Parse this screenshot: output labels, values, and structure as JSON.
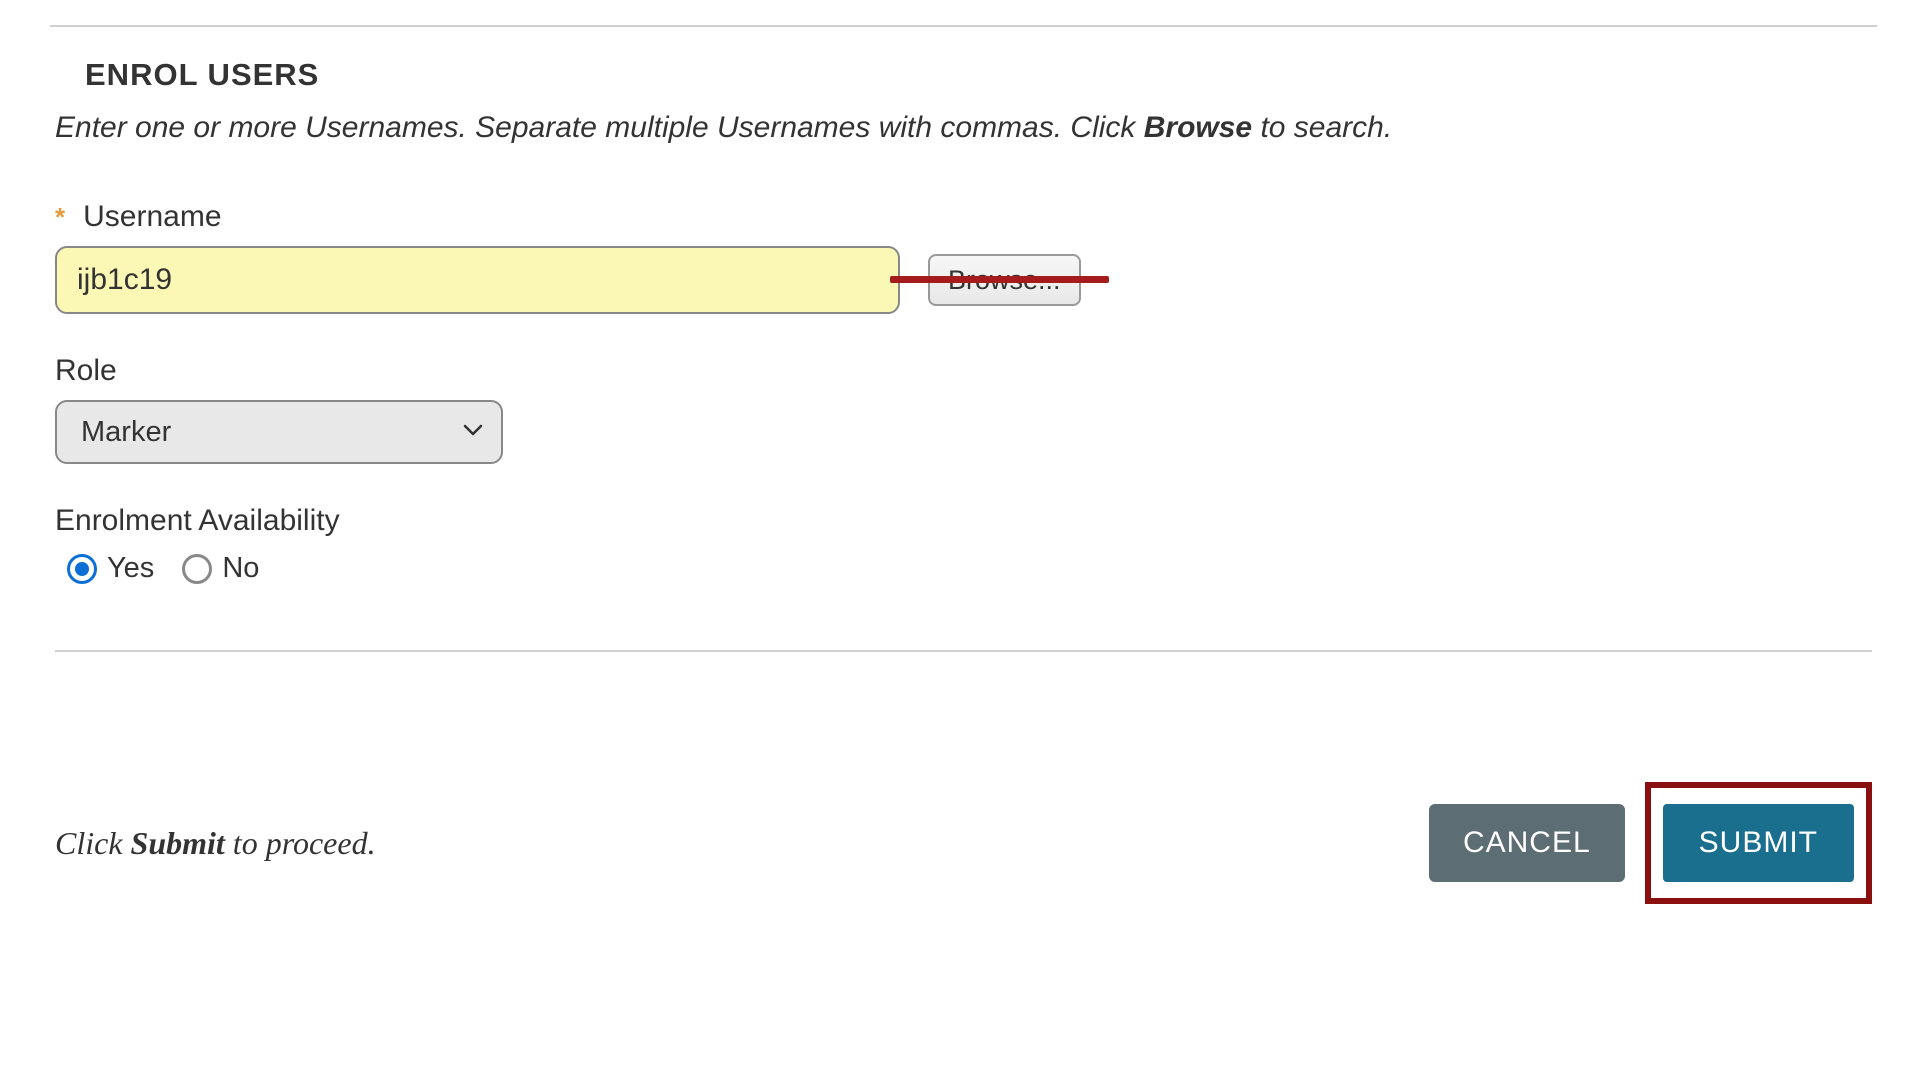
{
  "header": {
    "title": "ENROL USERS",
    "instructions_pre": "Enter one or more Usernames. Separate multiple Usernames with commas. Click ",
    "instructions_bold": "Browse",
    "instructions_post": " to search."
  },
  "form": {
    "username": {
      "label": "Username",
      "required_marker": "*",
      "value": "ijb1c19",
      "browse_label": "Browse..."
    },
    "role": {
      "label": "Role",
      "selected": "Marker"
    },
    "enrolment": {
      "label": "Enrolment Availability",
      "options": {
        "yes": "Yes",
        "no": "No"
      },
      "selected": "yes"
    }
  },
  "footer": {
    "instruction_pre": "Click ",
    "instruction_bold": "Submit",
    "instruction_post": " to proceed.",
    "cancel_label": "CANCEL",
    "submit_label": "SUBMIT"
  }
}
